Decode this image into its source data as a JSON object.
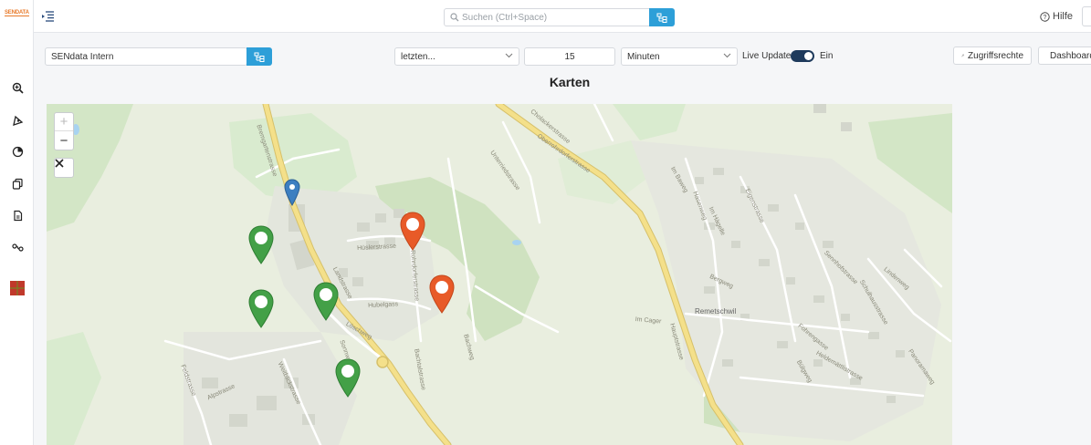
{
  "app": {
    "logo_text": "SENDATA"
  },
  "sidebar": {
    "items": [
      {
        "name": "zoom-search-icon"
      },
      {
        "name": "pen-tool-icon"
      },
      {
        "name": "pie-chart-icon"
      },
      {
        "name": "copy-icon"
      },
      {
        "name": "document-icon"
      },
      {
        "name": "route-icon"
      },
      {
        "name": "map-grid-icon"
      }
    ]
  },
  "header": {
    "search_placeholder": "Suchen (Ctrl+Space)",
    "help_label": "Hilfe"
  },
  "toolbar": {
    "tenant_value": "SENdata Intern",
    "period_select": "letzten...",
    "period_value": "15",
    "unit_select": "Minuten",
    "live_update_label": "Live Update",
    "live_update_state": "Ein",
    "live_update_on": true,
    "access_button": "Zugriffsrechte",
    "dashboard_button": "Dashboard"
  },
  "page": {
    "title": "Karten"
  },
  "map": {
    "controls": {
      "zoom_in": "+",
      "zoom_out": "−",
      "close": "✕"
    },
    "place_labels": [
      "Remetschwil"
    ],
    "street_labels": [
      "Bremgartenstrasse",
      "Landstrasse",
      "Cholackerstrasse",
      "Unterriedstrasse",
      "Oberrohrdorferstrasse",
      "Hüslerstrasse",
      "Rohrdorferstrasse",
      "Hubelgass",
      "Löschweg",
      "Bachtalstrasse",
      "Sennhofstrasse",
      "Lindenweg",
      "Bergweg",
      "Hauptstrasse",
      "Im Cager",
      "Heldemättlistrasse",
      "Fohrengasse",
      "Weitblickstrasse",
      "Alpstrasse",
      "Feldstrasse",
      "Im Baweg",
      "Im Hägelle",
      "Bachweg",
      "Sonnweg",
      "Eigenstrasse",
      "Hasenweg",
      "Schulhausstrasse",
      "Panoramaweg",
      "Bülgweg"
    ],
    "markers": [
      {
        "type": "blue",
        "color": "#3d7fc1"
      },
      {
        "type": "green",
        "color": "#43a047"
      },
      {
        "type": "green",
        "color": "#43a047"
      },
      {
        "type": "green",
        "color": "#43a047"
      },
      {
        "type": "green",
        "color": "#43a047"
      },
      {
        "type": "orange",
        "color": "#e85a28"
      },
      {
        "type": "orange",
        "color": "#e85a28"
      }
    ]
  },
  "colors": {
    "accent": "#2d9fd8",
    "toggle": "#1e3a5c",
    "map_background": "#e9eedf",
    "road_major": "#f4e08a"
  }
}
